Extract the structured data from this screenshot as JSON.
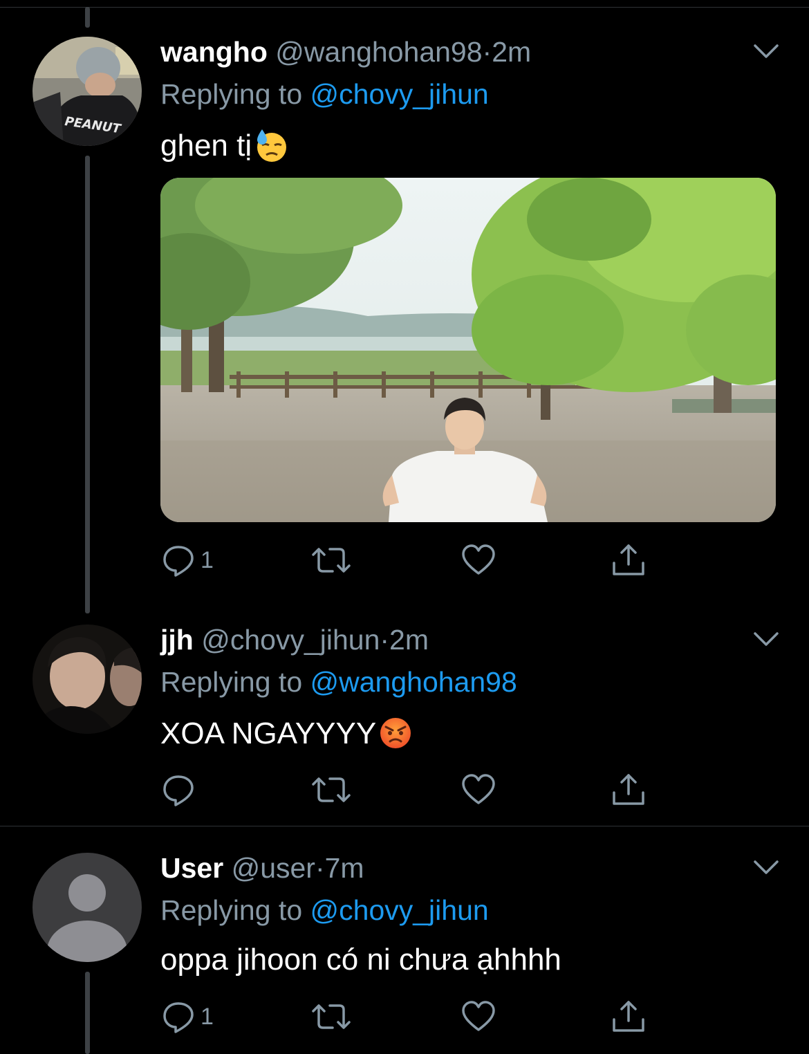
{
  "tweets": [
    {
      "name": "wangho",
      "handle": "@wanghohan98",
      "dot": "·",
      "time": "2m",
      "replying_prefix": "Replying to ",
      "replying_to": "@chovy_jihun",
      "text": "ghen tị",
      "emoji": "downcast-face-with-sweat",
      "avatar_text": "PEANUT",
      "reply_count": "1",
      "retweet_count": "",
      "like_count": ""
    },
    {
      "name": "jjh",
      "handle": "@chovy_jihun",
      "dot": "·",
      "time": "2m",
      "replying_prefix": "Replying to ",
      "replying_to": "@wanghohan98",
      "text": "XOA NGAYYYY",
      "emoji": "angry-face",
      "reply_count": "",
      "retweet_count": "",
      "like_count": ""
    },
    {
      "name": "User",
      "handle": "@user",
      "dot": "·",
      "time": "7m",
      "replying_prefix": "Replying to ",
      "replying_to": "@chovy_jihun",
      "text": "oppa jihoon có ni chưa ạhhhh",
      "reply_count": "1",
      "retweet_count": "",
      "like_count": ""
    }
  ],
  "colors": {
    "background": "#000000",
    "secondary_text": "#8899a6",
    "link": "#1d9bf0",
    "divider": "#2f3336"
  },
  "icons": [
    "chevron-down-icon",
    "reply-icon",
    "retweet-icon",
    "like-icon",
    "share-icon",
    "default-avatar-icon"
  ]
}
